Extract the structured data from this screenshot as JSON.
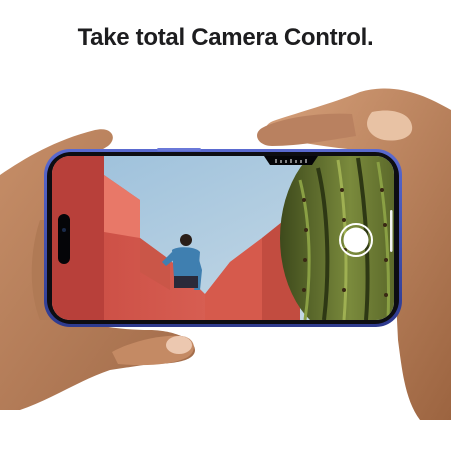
{
  "headline": "Take total Camera Control.",
  "camera": {
    "shutter_icon": "shutter-button-icon"
  },
  "colors": {
    "headline": "#1d1d1f",
    "phone_frame": "#3b4aa8",
    "sky": "#a9c8de",
    "wall": "#d85a4f",
    "cactus": "#5e6c2c"
  }
}
